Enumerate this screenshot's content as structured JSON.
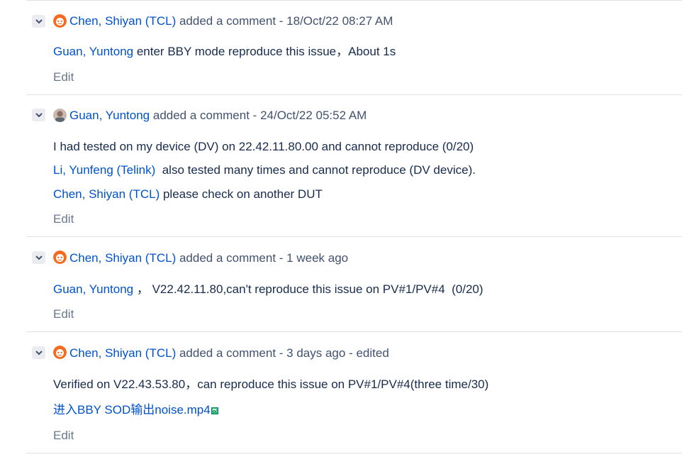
{
  "comments": [
    {
      "author": "Chen, Shiyan (TCL)",
      "action": "added a comment",
      "separator": " - ",
      "timestamp": "18/Oct/22 08:27 AM",
      "edited": "",
      "avatar": "orange-bot-avatar",
      "lines": [
        {
          "mention": "Guan, Yuntong",
          "text": " enter BBY mode reproduce this issue，About 1s"
        }
      ],
      "edit_label": "Edit"
    },
    {
      "author": "Guan, Yuntong",
      "action": "added a comment",
      "separator": " - ",
      "timestamp": "24/Oct/22 05:52 AM",
      "edited": "",
      "avatar": "user-photo-avatar",
      "lines": [
        {
          "mention": "",
          "text": "I had tested on my device (DV) on 22.42.11.80.00 and cannot reproduce (0/20)"
        },
        {
          "mention": "Li, Yunfeng (Telink)",
          "text": "  also tested many times and cannot reproduce (DV device)."
        },
        {
          "mention": "Chen, Shiyan (TCL)",
          "text": " please check on another DUT"
        }
      ],
      "edit_label": "Edit"
    },
    {
      "author": "Chen, Shiyan (TCL)",
      "action": "added a comment",
      "separator": " - ",
      "timestamp": "1 week ago",
      "edited": "",
      "avatar": "orange-bot-avatar",
      "lines": [
        {
          "mention": "Guan, Yuntong",
          "text": " ， V22.42.11.80,can't reproduce this issue on PV#1/PV#4  (0/20)"
        }
      ],
      "edit_label": "Edit"
    },
    {
      "author": "Chen, Shiyan (TCL)",
      "action": "added a comment",
      "separator": " - ",
      "timestamp": "3 days ago",
      "edited": " - edited",
      "avatar": "orange-bot-avatar",
      "lines": [
        {
          "mention": "",
          "text": "Verified on V22.43.53.80，can reproduce this issue on PV#1/PV#4(three time/30)"
        }
      ],
      "attachment": {
        "name": "进入BBY SOD输出noise.mp4",
        "icon": "attachment-icon"
      },
      "edit_label": "Edit"
    }
  ],
  "colors": {
    "link": "#0052cc",
    "text": "#172b4d",
    "muted": "#42526e",
    "edit": "#6b778c",
    "divider": "#dfe1e6",
    "toggle_bg": "#ebecf0"
  }
}
